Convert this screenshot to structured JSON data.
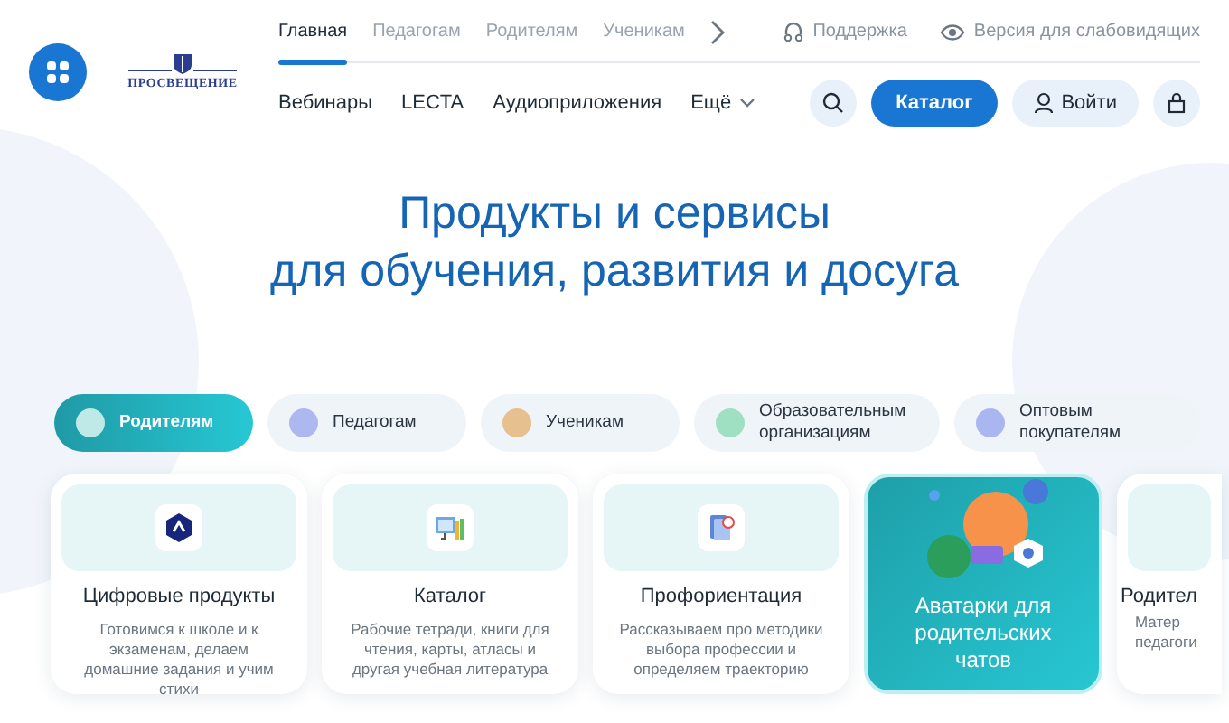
{
  "header": {
    "logo": {
      "text": "ПРОСВЕЩЕНИЕ"
    },
    "top_nav": [
      {
        "label": "Главная",
        "selected": true
      },
      {
        "label": "Педагогам",
        "selected": false
      },
      {
        "label": "Родителям",
        "selected": false
      },
      {
        "label": "Ученикам",
        "selected": false
      }
    ],
    "utility_links": [
      {
        "kind": "support",
        "label": "Поддержка"
      },
      {
        "kind": "eye",
        "label": "Версия для слабовидящих"
      }
    ],
    "sub_nav": [
      {
        "kind": "link",
        "label": "Вебинары"
      },
      {
        "kind": "link",
        "label": "LECTA"
      },
      {
        "kind": "link",
        "label": "Аудиоприложения"
      },
      {
        "kind": "dropdown",
        "label": "Ещё"
      }
    ],
    "catalog_button": "Каталог",
    "login_button": "Войти"
  },
  "hero": {
    "title_line_1": "Продукты и сервисы",
    "title_line_2": "для обучения, развития и досуга"
  },
  "audience_tabs": [
    {
      "label": "Родителям",
      "selected": true,
      "color": "#bfe9e6"
    },
    {
      "label": "Педагогам",
      "selected": false,
      "color": "#aeb8f0"
    },
    {
      "label": "Ученикам",
      "selected": false,
      "color": "#e6c08e"
    },
    {
      "label": "Образовательным организациям",
      "selected": false,
      "color": "#9fe0c2"
    },
    {
      "label": "Оптовым покупателям",
      "selected": false,
      "color": "#aab6f0"
    }
  ],
  "cards": [
    {
      "kind": "product",
      "title": "Цифровые продукты",
      "text": "Готовимся к школе и к экзаменам, делаем домашние задания и учим стихи"
    },
    {
      "kind": "product",
      "title": "Каталог",
      "text": "Рабочие тетради, книги для чтения, карты, атласы и другая учебная литература"
    },
    {
      "kind": "product",
      "title": "Профориентация",
      "text": "Рассказываем про методики выбора профессии и определяем траекторию"
    },
    {
      "kind": "featured",
      "title": "Аватарки для родительских чатов"
    },
    {
      "kind": "cut",
      "title": "Родител",
      "text_lines": [
        "Матер",
        "педагоги"
      ]
    }
  ]
}
